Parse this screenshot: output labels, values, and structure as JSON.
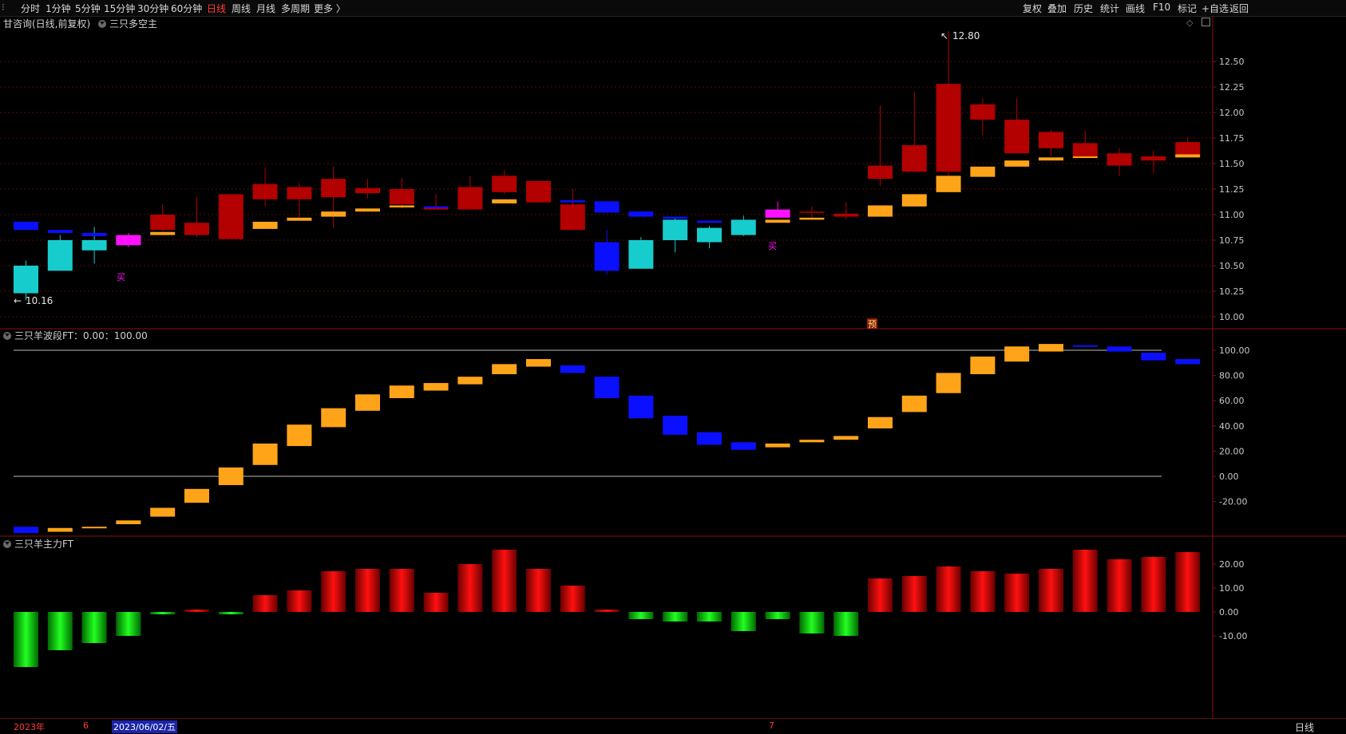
{
  "toolbar": {
    "left": [
      "分时",
      "1分钟",
      "5分钟",
      "15分钟",
      "30分钟",
      "60分钟",
      "日线",
      "周线",
      "月线",
      "多周期",
      "更多 〉"
    ],
    "active": "日线",
    "right": [
      "复权",
      "叠加",
      "历史",
      "统计",
      "画线",
      "F10",
      "标记",
      "+自选",
      "返回"
    ]
  },
  "panel1": {
    "title": "甘咨询(日线,前复权)",
    "indicator": "三只多空主",
    "high_label": "12.80",
    "low_label": "10.16",
    "buy_marks": [
      "买",
      "买"
    ],
    "yu_mark": "预",
    "y_ticks": [
      "12.50",
      "12.25",
      "12.00",
      "11.75",
      "11.50",
      "11.25",
      "11.00",
      "10.75",
      "10.50",
      "10.25",
      "10.00"
    ]
  },
  "panel2": {
    "title": "三只羊波段FT：0.00：100.00",
    "y_ticks": [
      "100.00",
      "80.00",
      "60.00",
      "40.00",
      "20.00",
      "0.00",
      "-20.00"
    ]
  },
  "panel3": {
    "title": "三只羊主力FT",
    "y_ticks": [
      "20.00",
      "10.00",
      "0.00",
      "-10.00"
    ]
  },
  "datebar": {
    "year": "2023年",
    "m6": "6",
    "selected": "2023/06/02/五",
    "m7": "7",
    "period": "日线"
  },
  "colors": {
    "up": "#b30000",
    "down_cyan": "#17cccc",
    "blue": "#0a10ff",
    "orange": "#ffa418",
    "magenta": "#ff10ff",
    "green": "#00d400"
  },
  "chart_data": [
    {
      "type": "candlestick",
      "title": "甘咨询(日线,前复权)",
      "ylim": [
        10.0,
        12.6
      ],
      "candles": [
        {
          "o": 10.5,
          "c": 10.23,
          "h": 10.55,
          "l": 10.16,
          "color": "cyan"
        },
        {
          "o": 10.45,
          "c": 10.75,
          "h": 10.8,
          "l": 10.45,
          "color": "cyan"
        },
        {
          "o": 10.75,
          "c": 10.65,
          "h": 10.88,
          "l": 10.52,
          "color": "cyan"
        },
        {
          "o": 10.8,
          "c": 10.7,
          "h": 10.82,
          "l": 10.68,
          "color": "magenta"
        },
        {
          "o": 10.85,
          "c": 11.0,
          "h": 11.1,
          "l": 10.84,
          "color": "red"
        },
        {
          "o": 10.8,
          "c": 10.92,
          "h": 11.17,
          "l": 10.78,
          "color": "red"
        },
        {
          "o": 10.76,
          "c": 11.2,
          "h": 11.2,
          "l": 10.76,
          "color": "red"
        },
        {
          "o": 11.15,
          "c": 11.3,
          "h": 11.46,
          "l": 11.08,
          "color": "red"
        },
        {
          "o": 11.15,
          "c": 11.27,
          "h": 11.31,
          "l": 10.97,
          "color": "red"
        },
        {
          "o": 11.17,
          "c": 11.35,
          "h": 11.47,
          "l": 10.87,
          "color": "red"
        },
        {
          "o": 11.21,
          "c": 11.26,
          "h": 11.35,
          "l": 11.16,
          "color": "red"
        },
        {
          "o": 11.1,
          "c": 11.25,
          "h": 11.36,
          "l": 11.06,
          "color": "red"
        },
        {
          "o": 11.05,
          "c": 11.08,
          "h": 11.2,
          "l": 11.05,
          "color": "red"
        },
        {
          "o": 11.05,
          "c": 11.27,
          "h": 11.38,
          "l": 11.05,
          "color": "red"
        },
        {
          "o": 11.22,
          "c": 11.38,
          "h": 11.44,
          "l": 11.2,
          "color": "red"
        },
        {
          "o": 11.12,
          "c": 11.33,
          "h": 11.33,
          "l": 11.12,
          "color": "red"
        },
        {
          "o": 10.85,
          "c": 11.1,
          "h": 11.25,
          "l": 10.85,
          "color": "red"
        },
        {
          "o": 10.73,
          "c": 10.45,
          "h": 10.85,
          "l": 10.41,
          "color": "blue"
        },
        {
          "o": 10.75,
          "c": 10.47,
          "h": 10.78,
          "l": 10.47,
          "color": "cyan"
        },
        {
          "o": 10.95,
          "c": 10.75,
          "h": 10.98,
          "l": 10.63,
          "color": "cyan"
        },
        {
          "o": 10.87,
          "c": 10.73,
          "h": 10.89,
          "l": 10.67,
          "color": "cyan"
        },
        {
          "o": 10.95,
          "c": 10.8,
          "h": 10.99,
          "l": 10.79,
          "color": "cyan"
        },
        {
          "o": 11.05,
          "c": 10.97,
          "h": 11.13,
          "l": 10.97,
          "color": "magenta"
        },
        {
          "o": 11.02,
          "c": 11.03,
          "h": 11.08,
          "l": 10.97,
          "color": "red"
        },
        {
          "o": 10.98,
          "c": 11.01,
          "h": 11.12,
          "l": 10.95,
          "color": "red"
        },
        {
          "o": 11.35,
          "c": 11.48,
          "h": 12.07,
          "l": 11.28,
          "color": "red"
        },
        {
          "o": 11.42,
          "c": 11.68,
          "h": 12.2,
          "l": 11.42,
          "color": "red"
        },
        {
          "o": 11.42,
          "c": 12.28,
          "h": 12.8,
          "l": 11.32,
          "color": "red"
        },
        {
          "o": 11.93,
          "c": 12.08,
          "h": 12.14,
          "l": 11.78,
          "color": "red"
        },
        {
          "o": 11.6,
          "c": 11.93,
          "h": 12.14,
          "l": 11.6,
          "color": "red"
        },
        {
          "o": 11.65,
          "c": 11.81,
          "h": 11.83,
          "l": 11.57,
          "color": "red"
        },
        {
          "o": 11.56,
          "c": 11.7,
          "h": 11.82,
          "l": 11.56,
          "color": "red"
        },
        {
          "o": 11.48,
          "c": 11.6,
          "h": 11.65,
          "l": 11.38,
          "color": "red"
        },
        {
          "o": 11.53,
          "c": 11.57,
          "h": 11.63,
          "l": 11.4,
          "color": "red"
        },
        {
          "o": 11.58,
          "c": 11.71,
          "h": 11.76,
          "l": 11.58,
          "color": "red"
        }
      ],
      "support_bars": [
        {
          "i": 0,
          "top": 10.93,
          "bot": 10.85,
          "color": "blue"
        },
        {
          "i": 1,
          "top": 10.85,
          "bot": 10.82,
          "color": "blue"
        },
        {
          "i": 2,
          "top": 10.82,
          "bot": 10.79,
          "color": "blue"
        },
        {
          "i": 4,
          "top": 10.83,
          "bot": 10.8,
          "color": "orange"
        },
        {
          "i": 7,
          "top": 10.93,
          "bot": 10.86,
          "color": "orange"
        },
        {
          "i": 8,
          "top": 10.97,
          "bot": 10.94,
          "color": "orange"
        },
        {
          "i": 9,
          "top": 11.03,
          "bot": 10.98,
          "color": "orange"
        },
        {
          "i": 10,
          "top": 11.06,
          "bot": 11.03,
          "color": "orange"
        },
        {
          "i": 11,
          "top": 11.09,
          "bot": 11.07,
          "color": "orange"
        },
        {
          "i": 12,
          "top": 11.08,
          "bot": 11.07,
          "color": "blue"
        },
        {
          "i": 14,
          "top": 11.15,
          "bot": 11.11,
          "color": "orange"
        },
        {
          "i": 16,
          "top": 11.14,
          "bot": 11.12,
          "color": "blue"
        },
        {
          "i": 17,
          "top": 11.13,
          "bot": 11.02,
          "color": "blue"
        },
        {
          "i": 18,
          "top": 11.03,
          "bot": 10.98,
          "color": "blue"
        },
        {
          "i": 19,
          "top": 10.98,
          "bot": 10.96,
          "color": "blue"
        },
        {
          "i": 20,
          "top": 10.94,
          "bot": 10.92,
          "color": "blue"
        },
        {
          "i": 22,
          "top": 10.95,
          "bot": 10.92,
          "color": "orange"
        },
        {
          "i": 23,
          "top": 10.97,
          "bot": 10.95,
          "color": "orange"
        },
        {
          "i": 25,
          "top": 11.09,
          "bot": 10.98,
          "color": "orange"
        },
        {
          "i": 26,
          "top": 11.2,
          "bot": 11.08,
          "color": "orange"
        },
        {
          "i": 27,
          "top": 11.38,
          "bot": 11.22,
          "color": "orange"
        },
        {
          "i": 28,
          "top": 11.47,
          "bot": 11.37,
          "color": "orange"
        },
        {
          "i": 29,
          "top": 11.53,
          "bot": 11.47,
          "color": "orange"
        },
        {
          "i": 30,
          "top": 11.56,
          "bot": 11.53,
          "color": "orange"
        },
        {
          "i": 31,
          "top": 11.57,
          "bot": 11.56,
          "color": "orange"
        },
        {
          "i": 34,
          "top": 11.59,
          "bot": 11.56,
          "color": "orange"
        }
      ]
    },
    {
      "type": "bar",
      "title": "三只羊波段FT",
      "ylim": [
        -45,
        110
      ],
      "bars": [
        {
          "i": 0,
          "from": -40,
          "to": -45,
          "color": "blue"
        },
        {
          "i": 1,
          "from": -41,
          "to": -44,
          "color": "orange"
        },
        {
          "i": 2,
          "from": -40,
          "to": -41,
          "color": "orange"
        },
        {
          "i": 3,
          "from": -35,
          "to": -38,
          "color": "orange"
        },
        {
          "i": 4,
          "from": -25,
          "to": -32,
          "color": "orange"
        },
        {
          "i": 5,
          "from": -10,
          "to": -21,
          "color": "orange"
        },
        {
          "i": 6,
          "from": 7,
          "to": -7,
          "color": "orange"
        },
        {
          "i": 7,
          "from": 26,
          "to": 9,
          "color": "orange"
        },
        {
          "i": 8,
          "from": 41,
          "to": 24,
          "color": "orange"
        },
        {
          "i": 9,
          "from": 54,
          "to": 39,
          "color": "orange"
        },
        {
          "i": 10,
          "from": 65,
          "to": 52,
          "color": "orange"
        },
        {
          "i": 11,
          "from": 72,
          "to": 62,
          "color": "orange"
        },
        {
          "i": 12,
          "from": 74,
          "to": 68,
          "color": "orange"
        },
        {
          "i": 13,
          "from": 79,
          "to": 73,
          "color": "orange"
        },
        {
          "i": 14,
          "from": 89,
          "to": 81,
          "color": "orange"
        },
        {
          "i": 15,
          "from": 93,
          "to": 87,
          "color": "orange"
        },
        {
          "i": 16,
          "from": 88,
          "to": 82,
          "color": "blue"
        },
        {
          "i": 17,
          "from": 79,
          "to": 62,
          "color": "blue"
        },
        {
          "i": 18,
          "from": 64,
          "to": 46,
          "color": "blue"
        },
        {
          "i": 19,
          "from": 48,
          "to": 33,
          "color": "blue"
        },
        {
          "i": 20,
          "from": 35,
          "to": 25,
          "color": "blue"
        },
        {
          "i": 21,
          "from": 27,
          "to": 21,
          "color": "blue"
        },
        {
          "i": 22,
          "from": 26,
          "to": 23,
          "color": "orange"
        },
        {
          "i": 23,
          "from": 29,
          "to": 27,
          "color": "orange"
        },
        {
          "i": 24,
          "from": 32,
          "to": 29,
          "color": "orange"
        },
        {
          "i": 25,
          "from": 47,
          "to": 38,
          "color": "orange"
        },
        {
          "i": 26,
          "from": 64,
          "to": 51,
          "color": "orange"
        },
        {
          "i": 27,
          "from": 82,
          "to": 66,
          "color": "orange"
        },
        {
          "i": 28,
          "from": 95,
          "to": 81,
          "color": "orange"
        },
        {
          "i": 29,
          "from": 103,
          "to": 91,
          "color": "orange"
        },
        {
          "i": 30,
          "from": 105,
          "to": 99,
          "color": "orange"
        },
        {
          "i": 31,
          "from": 104,
          "to": 103,
          "color": "blue"
        },
        {
          "i": 32,
          "from": 103,
          "to": 99,
          "color": "blue"
        },
        {
          "i": 33,
          "from": 98,
          "to": 92,
          "color": "blue"
        },
        {
          "i": 34,
          "from": 93,
          "to": 89,
          "color": "blue"
        }
      ],
      "ref_lines": [
        0,
        100
      ]
    },
    {
      "type": "bar",
      "title": "三只羊主力FT",
      "ylim": [
        -24,
        30
      ],
      "values": [
        -23,
        -16,
        -13,
        -10,
        -1,
        1,
        -1,
        7,
        9,
        17,
        18,
        18,
        8,
        20,
        26,
        18,
        11,
        1,
        -3,
        -4,
        -4,
        -8,
        -3,
        -9,
        -10,
        14,
        15,
        19,
        17,
        16,
        18,
        26,
        22,
        23,
        25
      ]
    }
  ]
}
